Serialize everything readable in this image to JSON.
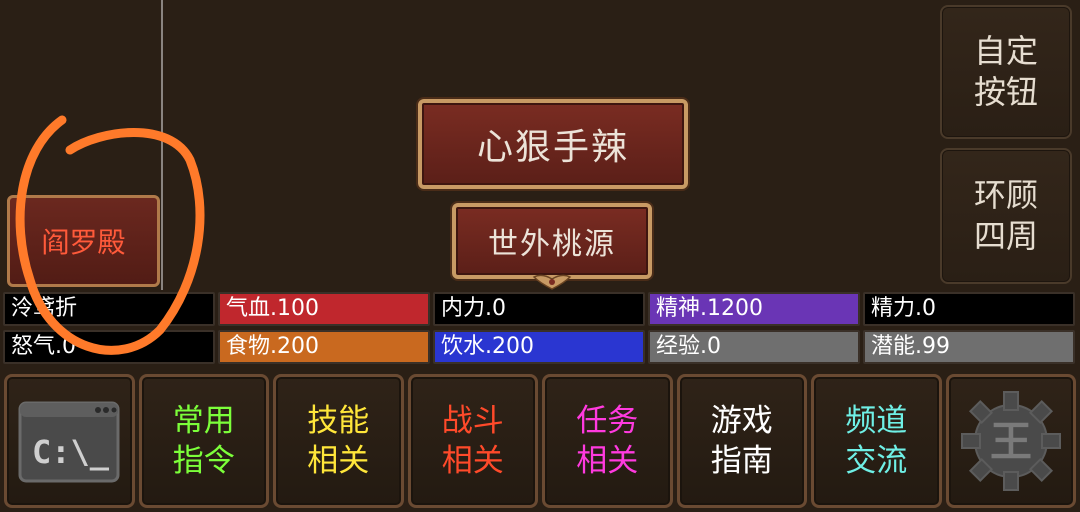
{
  "side_buttons": {
    "custom": "自定\n按钮",
    "look_around": "环顾\n四周"
  },
  "scene": {
    "skill_title": "心狠手辣",
    "location_title": "世外桃源",
    "location_left": "阎罗殿"
  },
  "stats": [
    [
      {
        "label": "泠鸢折",
        "bg": "#000000"
      },
      {
        "label": "气血.100",
        "bg": "#c0272d"
      },
      {
        "label": "内力.0",
        "bg": "#000000"
      },
      {
        "label": "精神.1200",
        "bg": "#6a35b5"
      },
      {
        "label": "精力.0",
        "bg": "#000000"
      }
    ],
    [
      {
        "label": "怒气.0",
        "bg": "#000000"
      },
      {
        "label": "食物.200",
        "bg": "#c9691f"
      },
      {
        "label": "饮水.200",
        "bg": "#2a36d1"
      },
      {
        "label": "经验.0",
        "bg": "#6f6f6f"
      },
      {
        "label": "潜能.99",
        "bg": "#6f6f6f"
      }
    ]
  ],
  "toolbar": {
    "terminal_icon": "terminal-icon",
    "terminal_text": "C:\\_",
    "items": [
      {
        "label": "常用\n指令",
        "color": "#7cff3a"
      },
      {
        "label": "技能\n相关",
        "color": "#ffe63a"
      },
      {
        "label": "战斗\n相关",
        "color": "#ff4a2a"
      },
      {
        "label": "任务\n相关",
        "color": "#ff3adf"
      },
      {
        "label": "游戏\n指南",
        "color": "#ffffff"
      },
      {
        "label": "频道\n交流",
        "color": "#6ff0e6"
      }
    ],
    "settings_icon": "gear-icon",
    "settings_letter": "王"
  },
  "annotation": {
    "color": "#ff7a2a"
  }
}
